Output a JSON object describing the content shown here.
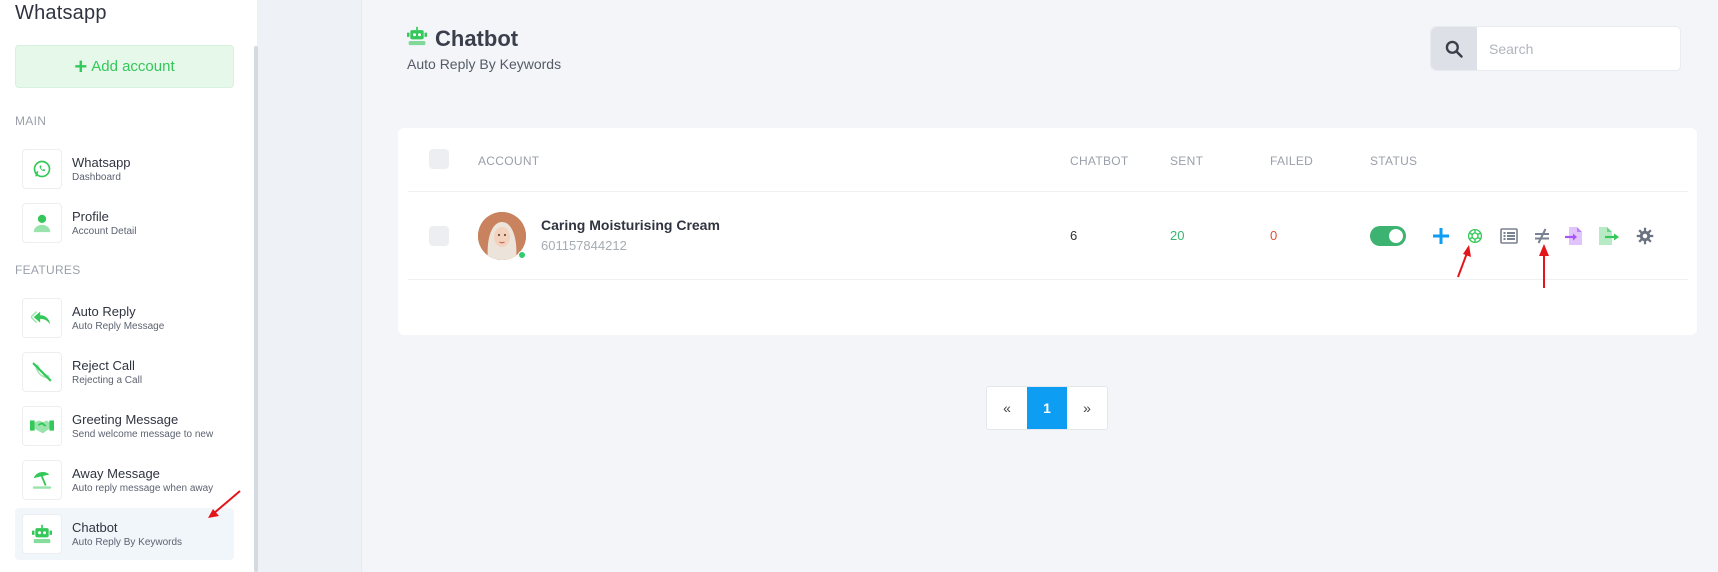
{
  "app": {
    "title": "Whatsapp"
  },
  "sidebar": {
    "add_account_label": "Add account",
    "section_main": "MAIN",
    "section_features": "FEATURES",
    "items": [
      {
        "title": "Whatsapp",
        "subtitle": "Dashboard",
        "icon": "whatsapp-icon"
      },
      {
        "title": "Profile",
        "subtitle": "Account Detail",
        "icon": "user-icon"
      },
      {
        "title": "Auto Reply",
        "subtitle": "Auto Reply Message",
        "icon": "reply-icon"
      },
      {
        "title": "Reject Call",
        "subtitle": "Rejecting a Call",
        "icon": "phone-slash-icon"
      },
      {
        "title": "Greeting Message",
        "subtitle": "Send welcome message to new",
        "icon": "handshake-icon"
      },
      {
        "title": "Away Message",
        "subtitle": "Auto reply message when away",
        "icon": "umbrella-beach-icon"
      },
      {
        "title": "Chatbot",
        "subtitle": "Auto Reply By Keywords",
        "icon": "robot-icon",
        "active": true
      }
    ]
  },
  "header": {
    "title": "Chatbot",
    "subtitle": "Auto Reply By Keywords"
  },
  "search": {
    "placeholder": "Search"
  },
  "table": {
    "columns": [
      "ACCOUNT",
      "CHATBOT",
      "SENT",
      "FAILED",
      "STATUS"
    ],
    "rows": [
      {
        "name": "Caring Moisturising Cream",
        "phone": "601157844212",
        "chatbot": "6",
        "sent": "20",
        "failed": "0",
        "status_on": true
      }
    ],
    "actions": [
      "add-icon",
      "openai-icon",
      "list-icon",
      "not-equal-icon",
      "file-import-icon",
      "file-export-icon",
      "gear-icon"
    ]
  },
  "pagination": {
    "prev": "«",
    "current": "1",
    "next": "»"
  },
  "colors": {
    "brand_green": "#34c759",
    "toggle_green": "#3cb371",
    "page_active": "#0d9df2",
    "sent_green": "#3cb371",
    "failed_red": "#e74c3c",
    "annotation_red": "#e3151a"
  }
}
